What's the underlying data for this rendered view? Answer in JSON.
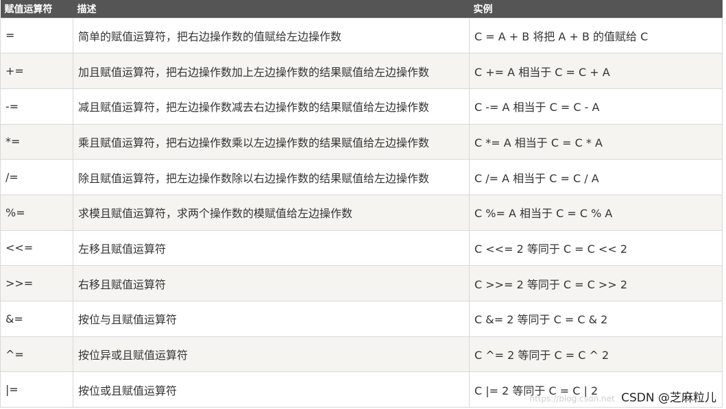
{
  "table": {
    "headers": [
      "赋值运算符",
      "描述",
      "实例"
    ],
    "rows": [
      {
        "op": "=",
        "desc": "简单的赋值运算符，把右边操作数的值赋给左边操作数",
        "example": "C = A + B 将把 A + B 的值赋给 C"
      },
      {
        "op": "+=",
        "desc": "加且赋值运算符，把右边操作数加上左边操作数的结果赋值给左边操作数",
        "example": "C += A 相当于 C = C + A"
      },
      {
        "op": "-=",
        "desc": "减且赋值运算符，把左边操作数减去右边操作数的结果赋值给左边操作数",
        "example": "C -= A 相当于 C = C - A"
      },
      {
        "op": "*=",
        "desc": "乘且赋值运算符，把右边操作数乘以左边操作数的结果赋值给左边操作数",
        "example": "C *= A 相当于 C = C * A"
      },
      {
        "op": "/=",
        "desc": "除且赋值运算符，把左边操作数除以右边操作数的结果赋值给左边操作数",
        "example": "C /= A 相当于 C = C / A"
      },
      {
        "op": "%=",
        "desc": "求模且赋值运算符，求两个操作数的模赋值给左边操作数",
        "example": "C %= A 相当于 C = C % A"
      },
      {
        "op": "<<=",
        "desc": "左移且赋值运算符",
        "example": "C <<= 2 等同于 C = C << 2"
      },
      {
        "op": ">>=",
        "desc": "右移且赋值运算符",
        "example": "C >>= 2 等同于 C = C >> 2"
      },
      {
        "op": "&=",
        "desc": "按位与且赋值运算符",
        "example": "C &= 2 等同于 C = C & 2"
      },
      {
        "op": "^=",
        "desc": "按位异或且赋值运算符",
        "example": "C ^= 2 等同于 C = C ^ 2"
      },
      {
        "op": "|=",
        "desc": "按位或且赋值运算符",
        "example": "C |= 2 等同于 C = C | 2"
      }
    ]
  },
  "watermark": {
    "url": "https://blog.csdn.net",
    "text": "CSDN @芝麻粒儿"
  }
}
